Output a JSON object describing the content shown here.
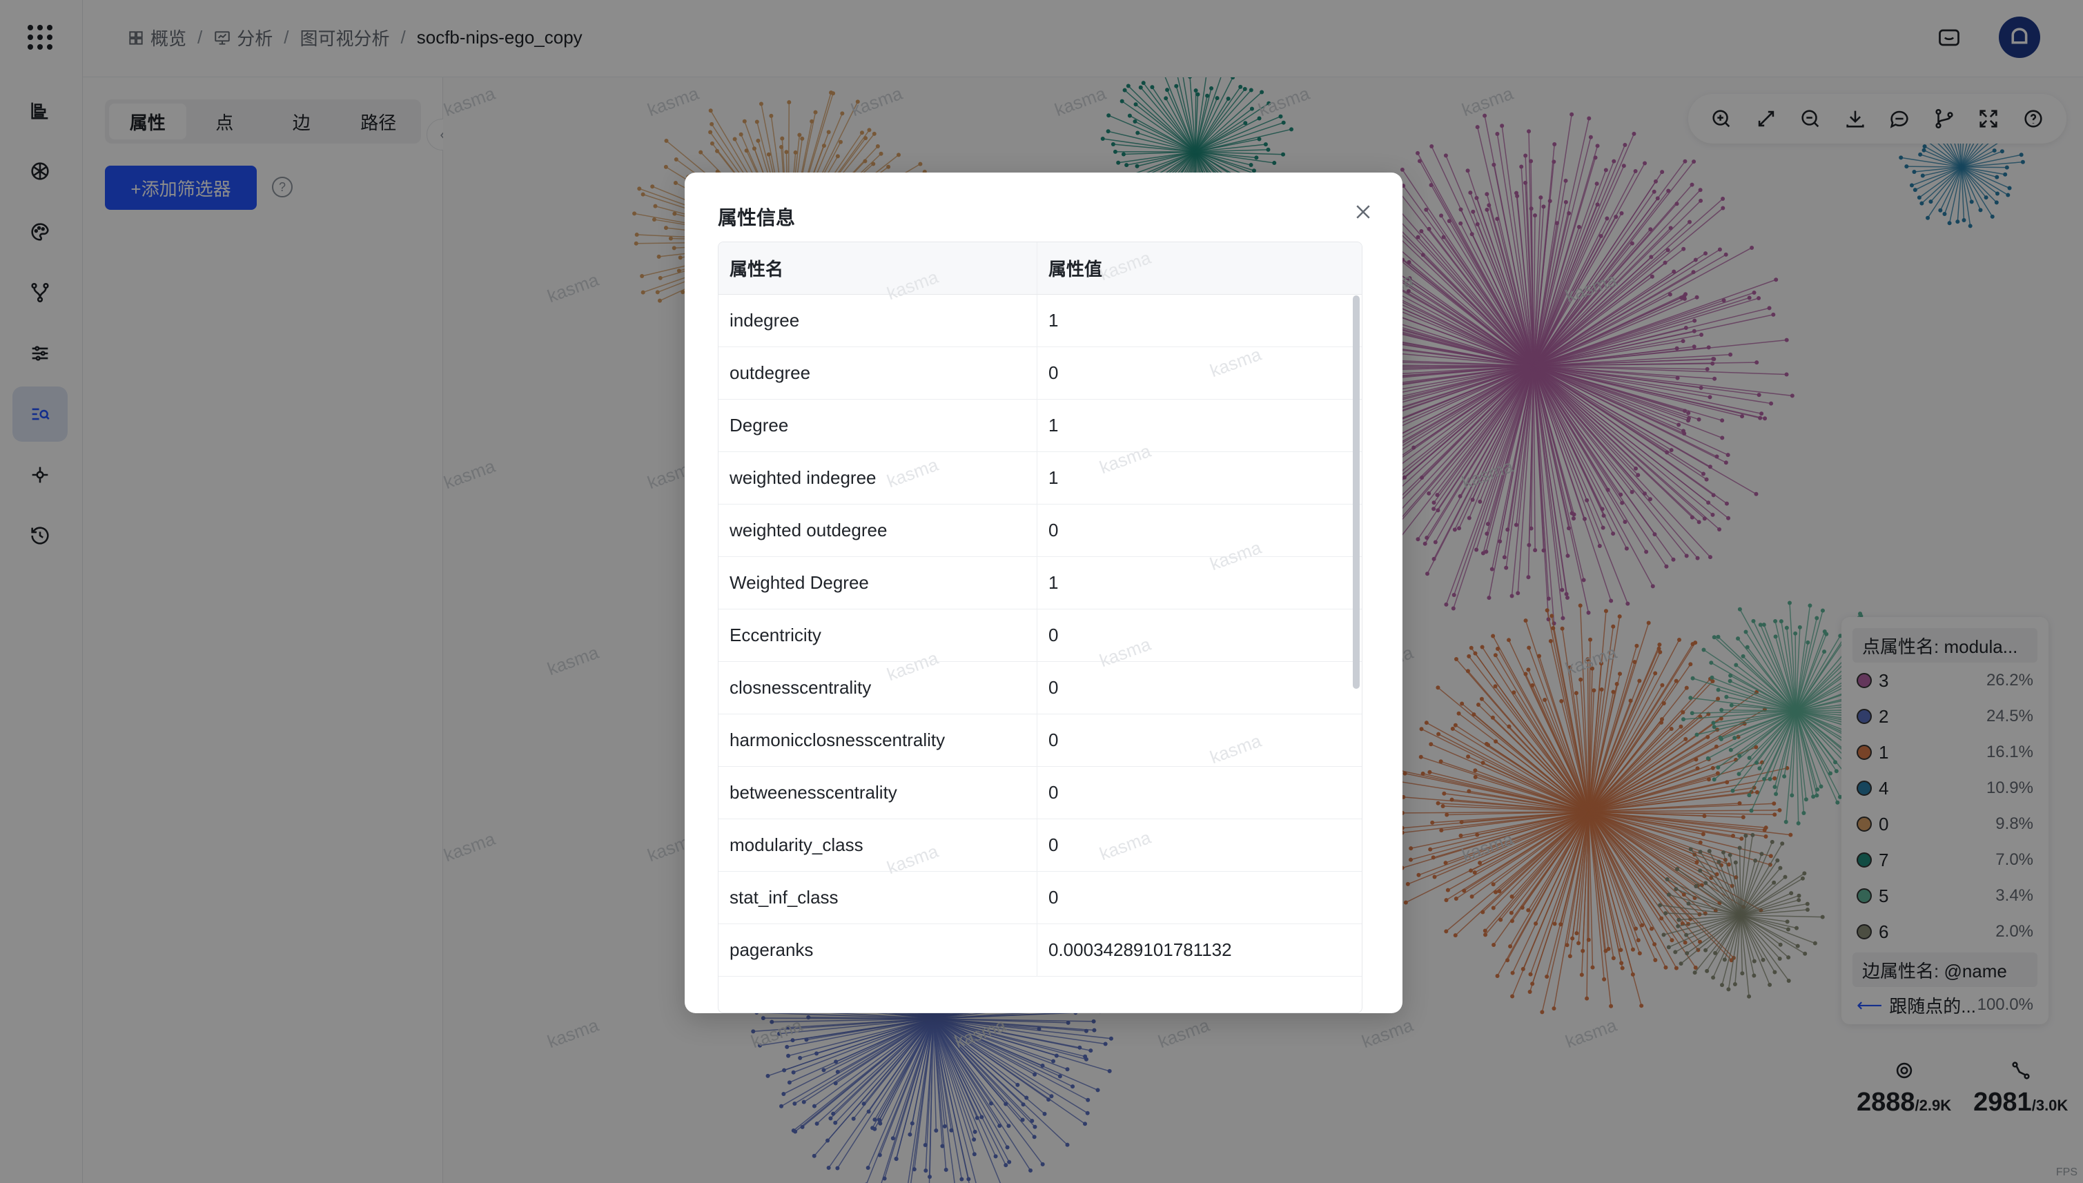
{
  "breadcrumbs": [
    {
      "label": "概览",
      "icon": "grid-icon"
    },
    {
      "label": "分析",
      "icon": "monitor-icon"
    },
    {
      "label": "图可视分析",
      "icon": ""
    },
    {
      "label": "socfb-nips-ego_copy",
      "icon": ""
    }
  ],
  "sidebar": {
    "items": [
      {
        "name": "dataset",
        "icon": "stack-icon"
      },
      {
        "name": "layout",
        "icon": "atom-icon"
      },
      {
        "name": "style",
        "icon": "palette-icon"
      },
      {
        "name": "algorithm",
        "icon": "fork-icon"
      },
      {
        "name": "filter",
        "icon": "sliders-icon"
      },
      {
        "name": "search",
        "icon": "search-list-icon",
        "active": true
      },
      {
        "name": "plugin",
        "icon": "plugin-icon"
      },
      {
        "name": "history",
        "icon": "history-icon"
      }
    ]
  },
  "panel": {
    "tabs": [
      "属性",
      "点",
      "边",
      "路径"
    ],
    "active_tab": "属性",
    "add_filter_label": "+添加筛选器",
    "help": "?"
  },
  "toolbar": {
    "icons": [
      "zoom-in-icon",
      "fit-view-icon",
      "zoom-out-icon",
      "download-icon",
      "comment-icon",
      "branch-icon",
      "fullscreen-icon",
      "help-icon"
    ]
  },
  "legend": {
    "node_header": "点属性名: modula...",
    "items": [
      {
        "label": "3",
        "pct": "26.2%",
        "color": "#b565a7"
      },
      {
        "label": "2",
        "pct": "24.5%",
        "color": "#5a6fc0"
      },
      {
        "label": "1",
        "pct": "16.1%",
        "color": "#d97a4a"
      },
      {
        "label": "4",
        "pct": "10.9%",
        "color": "#2a7fa8"
      },
      {
        "label": "0",
        "pct": "9.8%",
        "color": "#d9a066"
      },
      {
        "label": "7",
        "pct": "7.0%",
        "color": "#1f8a7a"
      },
      {
        "label": "5",
        "pct": "3.4%",
        "color": "#5fb59a"
      },
      {
        "label": "6",
        "pct": "2.0%",
        "color": "#8a8f78"
      }
    ],
    "edge_header": "边属性名: @name",
    "edge_item": {
      "label": "跟随点的...",
      "pct": "100.0%"
    }
  },
  "stats": {
    "nodes_shown": "2888",
    "nodes_total": "2.9K",
    "edges_shown": "2981",
    "edges_total": "3.0K"
  },
  "watermark": "kasma",
  "fps_label": "FPS",
  "modal": {
    "title": "属性信息",
    "col_name": "属性名",
    "col_value": "属性值",
    "rows": [
      {
        "name": "indegree",
        "value": "1"
      },
      {
        "name": "outdegree",
        "value": "0"
      },
      {
        "name": "Degree",
        "value": "1"
      },
      {
        "name": "weighted indegree",
        "value": "1"
      },
      {
        "name": "weighted outdegree",
        "value": "0"
      },
      {
        "name": "Weighted Degree",
        "value": "1"
      },
      {
        "name": "Eccentricity",
        "value": "0"
      },
      {
        "name": "closnesscentrality",
        "value": "0"
      },
      {
        "name": "harmonicclosnesscentrality",
        "value": "0"
      },
      {
        "name": "betweenesscentrality",
        "value": "0"
      },
      {
        "name": "modularity_class",
        "value": "0"
      },
      {
        "name": "stat_inf_class",
        "value": "0"
      },
      {
        "name": "pageranks",
        "value": "0.00034289101781132"
      }
    ]
  },
  "colors": {
    "primary": "#2454ff",
    "avatar": "#1e3a8a"
  }
}
